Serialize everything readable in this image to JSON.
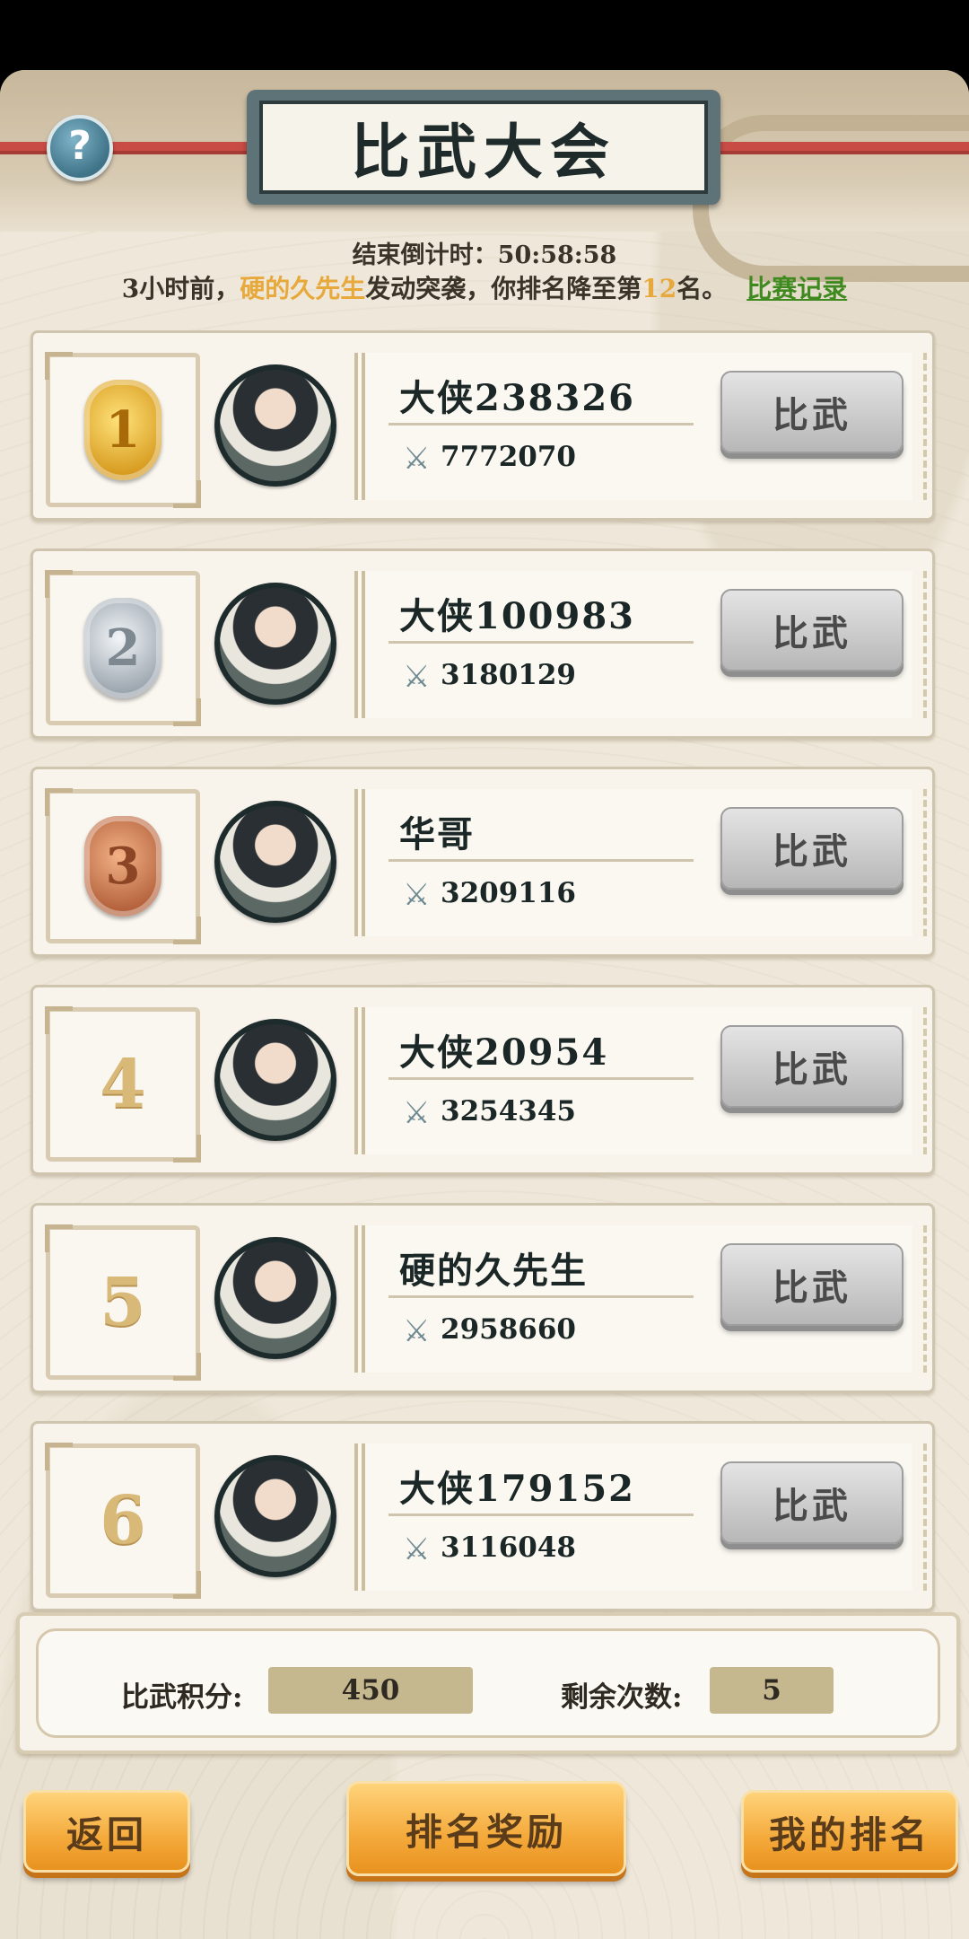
{
  "header": {
    "title": "比武大会",
    "help_icon": "question-mark-icon"
  },
  "countdown": {
    "label": "结束倒计时：",
    "value": "50:58:58"
  },
  "notice": {
    "prefix": "3小时前，",
    "attacker": "硬的久先生",
    "middle": "发动突袭，你排名降至第",
    "rank": "12",
    "suffix": "名。",
    "record_link": "比赛记录"
  },
  "fight_label": "比武",
  "rankings": [
    {
      "rank": "1",
      "medal": "gold",
      "name": "大侠238326",
      "power": "7772070"
    },
    {
      "rank": "2",
      "medal": "silver",
      "name": "大侠100983",
      "power": "3180129"
    },
    {
      "rank": "3",
      "medal": "bronze",
      "name": "华哥",
      "power": "3209116"
    },
    {
      "rank": "4",
      "medal": "",
      "name": "大侠20954",
      "power": "3254345"
    },
    {
      "rank": "5",
      "medal": "",
      "name": "硬的久先生",
      "power": "2958660"
    },
    {
      "rank": "6",
      "medal": "",
      "name": "大侠179152",
      "power": "3116048"
    }
  ],
  "stats": {
    "points_label": "比武积分:",
    "points_value": "450",
    "remaining_label": "剩余次数:",
    "remaining_value": "5"
  },
  "buttons": {
    "back": "返回",
    "ranking_rewards": "排名奖励",
    "my_ranking": "我的排名"
  },
  "colors": {
    "highlight": "#e7a93b",
    "link": "#3f8a1e",
    "button_orange": "#f4a93a"
  }
}
